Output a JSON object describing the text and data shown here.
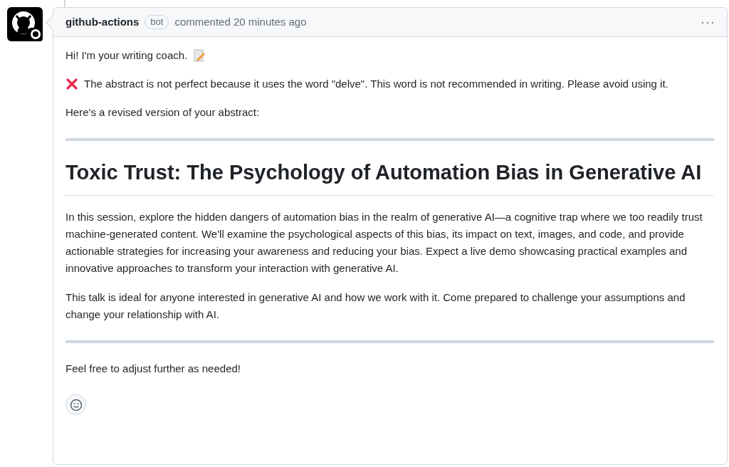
{
  "comment": {
    "author": "github-actions",
    "author_badge": "bot",
    "meta": "commented 20 minutes ago",
    "menu": "···",
    "body": [
      {
        "kind": "greeting",
        "text": "Hi! I'm your writing coach."
      },
      {
        "kind": "warning",
        "text": "The abstract is not perfect because it uses the word \"delve\". This word is not recommended in writing. Please avoid using it."
      },
      {
        "kind": "text",
        "text": "Here's a revised version of your abstract:"
      },
      {
        "kind": "rule"
      },
      {
        "kind": "heading",
        "text": "Toxic Trust: The Psychology of Automation Bias in Generative AI"
      },
      {
        "kind": "text",
        "text": "In this session, explore the hidden dangers of automation bias in the realm of generative AI—a cognitive trap where we too readily trust machine-generated content. We'll examine the psychological aspects of this bias, its impact on text, images, and code, and provide actionable strategies for increasing your awareness and reducing your bias. Expect a live demo showcasing practical examples and innovative approaches to transform your interaction with generative AI."
      },
      {
        "kind": "text",
        "text": "This talk is ideal for anyone interested in generative AI and how we work with it. Come prepared to challenge your assumptions and change your relationship with AI."
      },
      {
        "kind": "rule"
      },
      {
        "kind": "text",
        "text": "Feel free to adjust further as needed!"
      }
    ]
  }
}
